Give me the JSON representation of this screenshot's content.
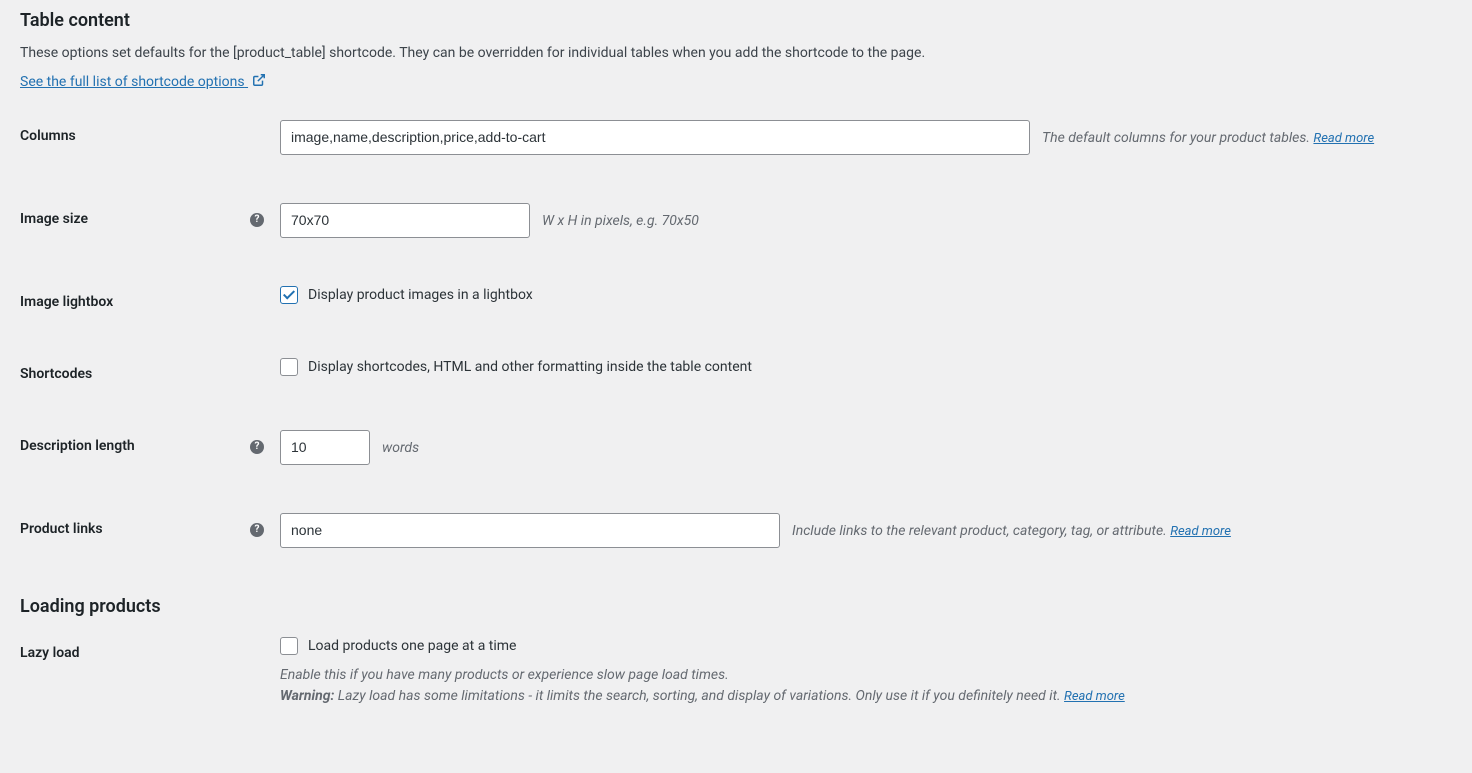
{
  "section1": {
    "title": "Table content",
    "intro": "These options set defaults for the [product_table] shortcode. They can be overridden for individual tables when you add the shortcode to the page.",
    "full_list_link": "See the full list of shortcode options"
  },
  "fields": {
    "columns": {
      "label": "Columns",
      "value": "image,name,description,price,add-to-cart",
      "help_text": "The default columns for your product tables. ",
      "read_more": "Read more"
    },
    "image_size": {
      "label": "Image size",
      "value": "70x70",
      "hint": "W x H in pixels, e.g. 70x50"
    },
    "image_lightbox": {
      "label": "Image lightbox",
      "checkbox_label": "Display product images in a lightbox",
      "checked": true
    },
    "shortcodes": {
      "label": "Shortcodes",
      "checkbox_label": "Display shortcodes, HTML and other formatting inside the table content",
      "checked": false
    },
    "description_length": {
      "label": "Description length",
      "value": "10",
      "hint": "words"
    },
    "product_links": {
      "label": "Product links",
      "value": "none",
      "help_text": "Include links to the relevant product, category, tag, or attribute. ",
      "read_more": "Read more"
    }
  },
  "section2": {
    "title": "Loading products"
  },
  "lazy_load": {
    "label": "Lazy load",
    "checkbox_label": "Load products one page at a time",
    "checked": false,
    "desc1": "Enable this if you have many products or experience slow page load times.",
    "warning_prefix": "Warning:",
    "desc2": " Lazy load has some limitations - it limits the search, sorting, and display of variations. Only use it if you definitely need it. ",
    "read_more": "Read more"
  }
}
